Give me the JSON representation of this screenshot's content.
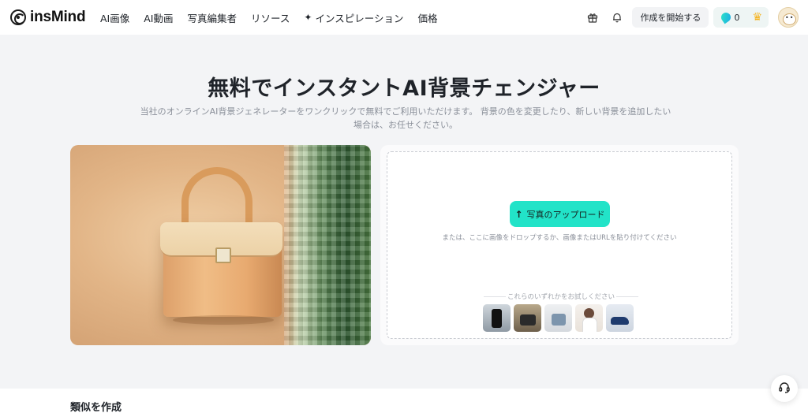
{
  "brand": {
    "name": "insMind"
  },
  "nav": {
    "items": [
      {
        "label": "AI画像"
      },
      {
        "label": "AI動画"
      },
      {
        "label": "写真編集者"
      },
      {
        "label": "リソース"
      },
      {
        "label": "インスピレーション"
      },
      {
        "label": "価格"
      }
    ],
    "create_label": "作成を開始する",
    "credits": "0"
  },
  "hero": {
    "title": "無料でインスタントAI背景チェンジャー",
    "subtitle": "当社のオンラインAI背景ジェネレーターをワンクリックで無料でご利用いただけます。 背景の色を変更したり、新しい背景を追加したい場合は、お任せください。"
  },
  "upload": {
    "button_label": "写真のアップロード",
    "hint": "または、ここに画像をドロップするか、画像またはURLを貼り付けてください",
    "try_label": "これらのいずれかをお試しください",
    "samples": [
      "sample-bottle",
      "sample-bag-dark",
      "sample-bag-blue",
      "sample-model",
      "sample-shoe"
    ]
  },
  "section": {
    "title": "類似を作成"
  },
  "colors": {
    "accent": "#22e3c8",
    "background": "#f3f4f6",
    "text": "#1f2329",
    "muted": "#8a8f99"
  },
  "icons": [
    "gift-icon",
    "bell-icon",
    "credit-gem-icon",
    "crown-icon",
    "avatar",
    "upload-icon",
    "headset-icon"
  ]
}
